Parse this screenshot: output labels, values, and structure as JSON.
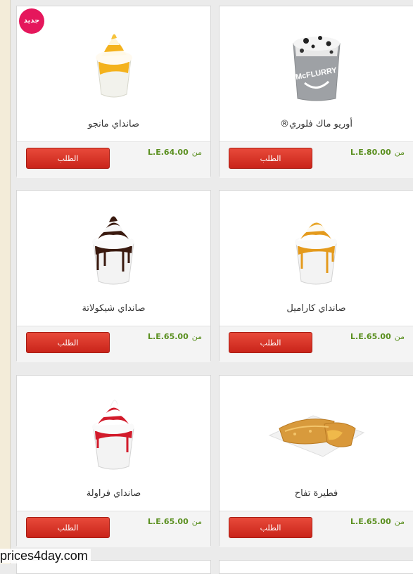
{
  "products": [
    {
      "name": "صانداي مانجو",
      "price": "L.E.64.00",
      "from": "من",
      "button": "الطلب",
      "badge": "جديد",
      "icon": "mango-sundae-icon"
    },
    {
      "name": "أوريو ماك فلوري®",
      "price": "L.E.80.00",
      "from": "من",
      "button": "الطلب",
      "icon": "oreo-mcflurry-icon",
      "cup_text": "McFLURRY"
    },
    {
      "name": "صانداي شيكولاتة",
      "price": "L.E.65.00",
      "from": "من",
      "button": "الطلب",
      "icon": "chocolate-sundae-icon"
    },
    {
      "name": "صانداي كاراميل",
      "price": "L.E.65.00",
      "from": "من",
      "button": "الطلب",
      "icon": "caramel-sundae-icon"
    },
    {
      "name": "صانداي فراولة",
      "price": "L.E.65.00",
      "from": "من",
      "button": "الطلب",
      "icon": "strawberry-sundae-icon"
    },
    {
      "name": "فطيرة تفاح",
      "price": "L.E.65.00",
      "from": "من",
      "button": "الطلب",
      "icon": "apple-pie-icon"
    }
  ],
  "watermark": "prices4day.com",
  "colors": {
    "button": "#d93325",
    "price": "#5a8f1f",
    "badge": "#e5175c"
  }
}
